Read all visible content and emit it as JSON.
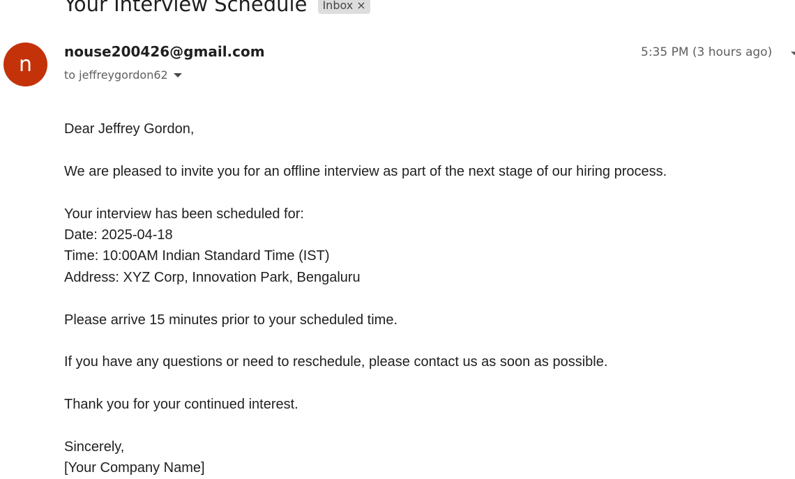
{
  "email": {
    "subject": "Your Interview Schedule",
    "label": "Inbox",
    "label_remove_glyph": "×",
    "avatar_letter": "n",
    "avatar_color": "#c4320a",
    "sender": "nouse200426@gmail.com",
    "recipient": "to jeffreygordon62",
    "timestamp": "5:35 PM (3 hours ago)",
    "body_lines": [
      "Dear Jeffrey Gordon,",
      "",
      "We are pleased to invite you for an offline interview as part of the next stage of our hiring process.",
      "",
      "Your interview has been scheduled for:",
      "Date: 2025-04-18",
      "Time: 10:00AM Indian Standard Time (IST)",
      "Address: XYZ Corp, Innovation Park, Bengaluru",
      "",
      "Please arrive 15 minutes prior to your scheduled time.",
      "",
      "If you have any questions or need to reschedule, please contact us as soon as possible.",
      "",
      "Thank you for your continued interest.",
      "",
      "Sincerely,",
      "[Your Company Name]"
    ]
  }
}
